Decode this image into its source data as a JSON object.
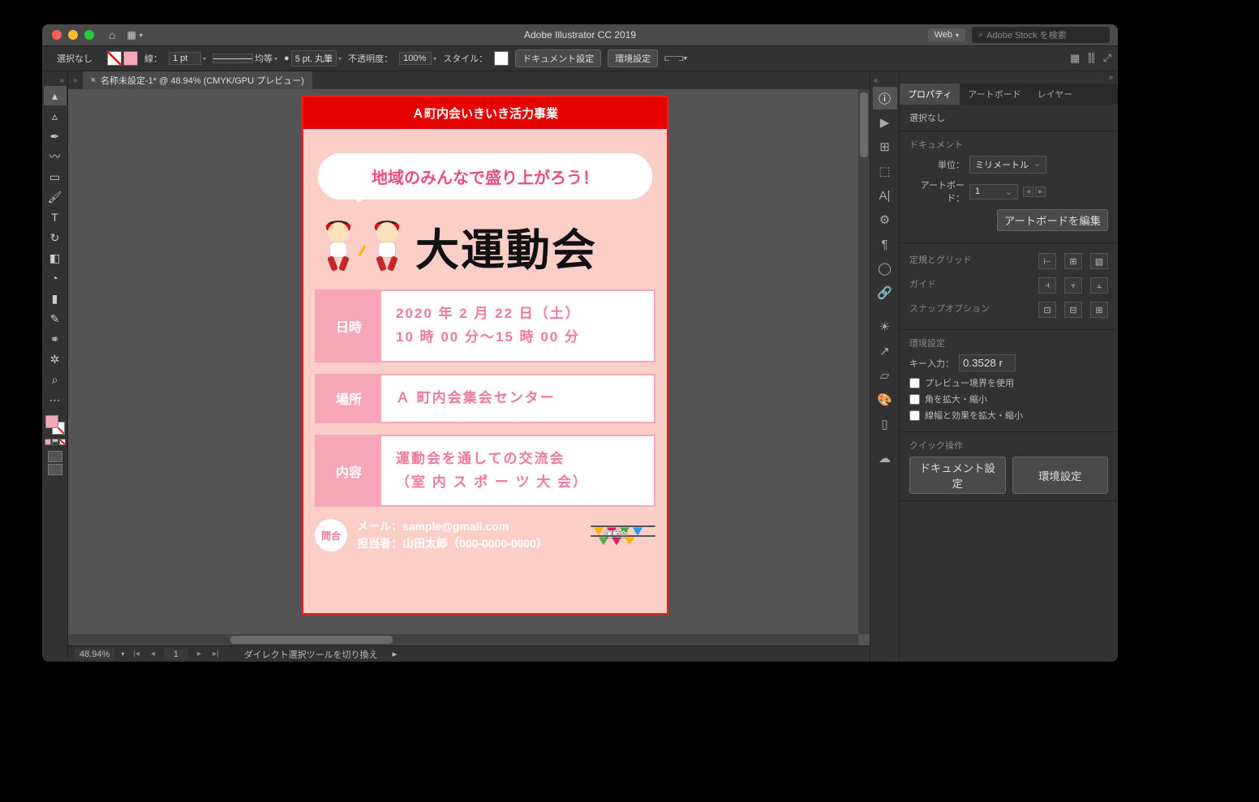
{
  "title": "Adobe Illustrator CC 2019",
  "workspace": {
    "label": "Web"
  },
  "stock_search_placeholder": "Adobe Stock を検索",
  "optionbar": {
    "selection": "選択なし",
    "stroke_label": "線：",
    "stroke_weight": "1 pt",
    "dash_label": "均等",
    "brush_size": "5 pt. 丸筆",
    "opacity_label": "不透明度：",
    "opacity_value": "100%",
    "style_label": "スタイル：",
    "doc_setup": "ドキュメント設定",
    "prefs": "環境設定"
  },
  "document_tab": {
    "name": "名称未設定-1* @ 48.94% (CMYK/GPU プレビュー)"
  },
  "flyer": {
    "header": "Ａ町内会いきいき活力事業",
    "speech": "地域のみんなで盛り上がろう！",
    "title": "大運動会",
    "rows": [
      {
        "label": "日時",
        "line1": "2020 年 2 月 22 日（土）",
        "line2": "10 時 00 分～15 時 00 分"
      },
      {
        "label": "場所",
        "line1": "Ａ 町内会集会センター",
        "line2": ""
      },
      {
        "label": "内容",
        "line1": "運動会を通しての交流会",
        "line2": "（室 内 ス ポ ー ツ 大 会）"
      }
    ],
    "contact_badge": "問合",
    "contact_mail": "メール：sample@gmail.com",
    "contact_person": "担当者：山田太郎（000-0000-0000）",
    "bunting_label": "運動会"
  },
  "statusbar": {
    "zoom": "48.94%",
    "artboard_num": "1",
    "hint": "ダイレクト選択ツールを切り換え"
  },
  "panels": {
    "tabs": [
      "プロパティ",
      "アートボード",
      "レイヤー"
    ],
    "selection": "選択なし",
    "section_document": "ドキュメント",
    "unit_label": "単位：",
    "unit_value": "ミリメートル",
    "artboard_label": "アートボード：",
    "artboard_value": "1",
    "edit_artboard": "アートボードを編集",
    "section_ruler": "定規とグリッド",
    "section_guide": "ガイド",
    "section_snap": "スナップオプション",
    "section_prefs": "環境設定",
    "key_input_label": "キー入力：",
    "key_input_value": "0.3528 r",
    "check_preview": "プレビュー境界を使用",
    "check_scale_corners": "角を拡大・縮小",
    "check_scale_strokes": "線幅と効果を拡大・縮小",
    "section_quick": "クイック操作",
    "btn_doc_setup": "ドキュメント設定",
    "btn_prefs": "環境設定"
  }
}
